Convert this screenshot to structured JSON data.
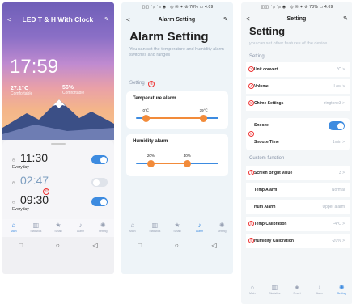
{
  "status": {
    "left": "◫◫ ⁺ᵢₗₗ ⁺ᵢₗₗ ◉",
    "right": "◎ ✉ ✶ ⊘ 78% ▭ 4:09"
  },
  "icons": {
    "back": "<",
    "edit": "✎"
  },
  "phone1": {
    "title": "LED T & H With Clock",
    "clock": "17:59",
    "temperature": {
      "value": "27.1℃",
      "label": "Comfortable"
    },
    "humidity": {
      "value": "56%",
      "label": "Comfortable"
    },
    "alarms": [
      {
        "time": "11:30",
        "repeat": "Everyday",
        "enabled": true
      },
      {
        "time": "02:47",
        "repeat": "",
        "enabled": false
      },
      {
        "time": "09:30",
        "repeat": "Everyday",
        "enabled": true
      }
    ],
    "marker": "①"
  },
  "tabs": [
    {
      "label": "Main",
      "icon": "⌂"
    },
    {
      "label": "Statistics",
      "icon": "▥"
    },
    {
      "label": "Smart",
      "icon": "★"
    },
    {
      "label": "Alarm",
      "icon": "♪"
    },
    {
      "label": "Setting",
      "icon": "✺"
    }
  ],
  "nav": {
    "recent": "□",
    "home": "○",
    "back": "◁"
  },
  "phone2": {
    "header": "Alarm Setting",
    "title": "Alarm Setting",
    "subtitle": "You can set the temperature and humidity alarm switches and ranges",
    "section": "Setting",
    "marker": "②",
    "temp_alarm": {
      "title": "Temperature alarm",
      "low": "0℃",
      "high": "39℃",
      "low_pct": 0.12,
      "high_pct": 0.82
    },
    "hum_alarm": {
      "title": "Humidity alarm",
      "low": "20%",
      "high": "40%",
      "low_pct": 0.18,
      "high_pct": 0.62
    }
  },
  "phone3": {
    "header": "Setting",
    "title": "Setting",
    "subtitle": "you can set other features of the device",
    "section1": "Setting",
    "rows": [
      {
        "mark": "3",
        "label": "Unit convert",
        "value": "℃ >"
      },
      {
        "mark": "4",
        "label": "Volume",
        "value": "Low >"
      },
      {
        "mark": "5",
        "label": "Chime Settings",
        "value": "ringtone3 >"
      }
    ],
    "snooze": {
      "mark": "6",
      "label": "Snooze",
      "time_label": "Snooze Time",
      "time_value": "1min >"
    },
    "section2": "Custom function",
    "rows2": [
      {
        "mark": "7",
        "label": "Screen Bright Value",
        "value": "3 >"
      },
      {
        "mark": "",
        "label": "Temp Alarm",
        "value": "Normal"
      },
      {
        "mark": "",
        "label": "Hum Alarm",
        "value": "Upper alarm"
      },
      {
        "mark": "8",
        "label": "Temp Calibration",
        "value": "-4℃ >"
      },
      {
        "mark": "9",
        "label": "Humidity Calibration",
        "value": "-20% >"
      }
    ]
  },
  "colors": {
    "accent": "#3d8be0",
    "slider": "#f28b3a",
    "marker": "#ee3333"
  }
}
